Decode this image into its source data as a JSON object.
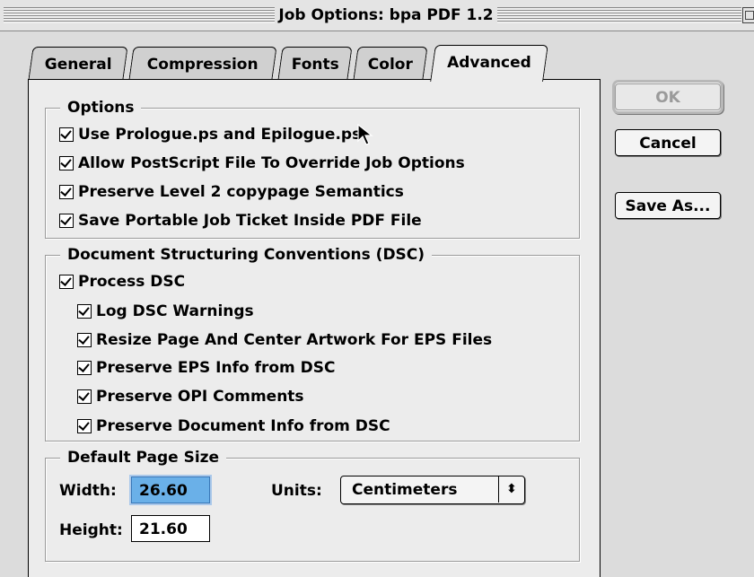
{
  "window": {
    "title": "Job Options: bpa PDF 1.2"
  },
  "tabs": [
    {
      "label": "General"
    },
    {
      "label": "Compression"
    },
    {
      "label": "Fonts"
    },
    {
      "label": "Color"
    },
    {
      "label": "Advanced",
      "active": true
    }
  ],
  "options": {
    "title": "Options",
    "items": [
      {
        "label": "Use Prologue.ps and Epilogue.ps",
        "checked": true
      },
      {
        "label": "Allow PostScript File To Override Job Options",
        "checked": true
      },
      {
        "label": "Preserve Level 2 copypage Semantics",
        "checked": true
      },
      {
        "label": "Save Portable Job Ticket Inside PDF File",
        "checked": true
      }
    ]
  },
  "dsc": {
    "title": "Document Structuring Conventions (DSC)",
    "process": {
      "label": "Process DSC",
      "checked": true
    },
    "items": [
      {
        "label": "Log DSC Warnings",
        "checked": true
      },
      {
        "label": "Resize Page And Center Artwork For EPS Files",
        "checked": true
      },
      {
        "label": "Preserve EPS Info from DSC",
        "checked": true
      },
      {
        "label": "Preserve OPI Comments",
        "checked": true
      },
      {
        "label": "Preserve Document Info from DSC",
        "checked": true
      }
    ]
  },
  "page_size": {
    "title": "Default Page Size",
    "width_label": "Width:",
    "width_value": "26.60",
    "height_label": "Height:",
    "height_value": "21.60",
    "units_label": "Units:",
    "units_value": "Centimeters"
  },
  "buttons": {
    "ok": "OK",
    "cancel": "Cancel",
    "save_as": "Save As..."
  },
  "colors": {
    "selection": "#6ab0e8",
    "panel": "#ececec",
    "background": "#dcdcdc"
  }
}
